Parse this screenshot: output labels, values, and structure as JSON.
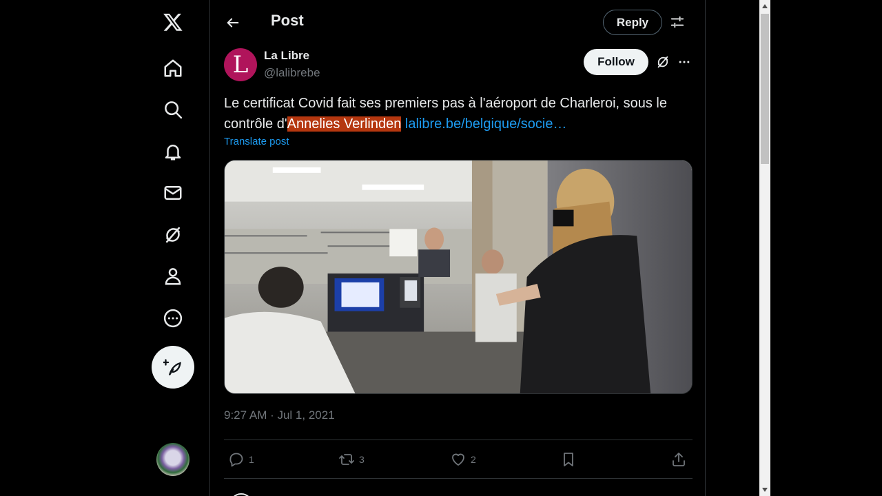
{
  "nav": {
    "items": [
      {
        "name": "x-logo-icon"
      },
      {
        "name": "home-icon"
      },
      {
        "name": "search-icon"
      },
      {
        "name": "bell-icon"
      },
      {
        "name": "mail-icon"
      },
      {
        "name": "grok-icon"
      },
      {
        "name": "profile-icon"
      },
      {
        "name": "more-circle-icon"
      }
    ],
    "post_button_icon": "feather-plus-icon"
  },
  "header": {
    "title": "Post",
    "reply_label": "Reply"
  },
  "tweet": {
    "author_initial": "L",
    "author_name": "La Libre",
    "author_handle": "@lalibrebe",
    "follow_label": "Follow",
    "text_before": "Le certificat Covid fait ses premiers pas à l'aéroport de Charleroi, sous le contrôle d'",
    "text_highlight": "Annelies Verlinden",
    "link_text": "lalibre.be/belgique/socie…",
    "translate_label": "Translate post",
    "timestamp": "9:27 AM · Jul 1, 2021",
    "stats": {
      "replies": "1",
      "reposts": "3",
      "likes": "2"
    }
  },
  "colors": {
    "background": "#000000",
    "accent": "#1d9bf0",
    "highlight": "#b5370f",
    "avatar_brand": "#b0145b",
    "muted_text": "#71767b"
  }
}
